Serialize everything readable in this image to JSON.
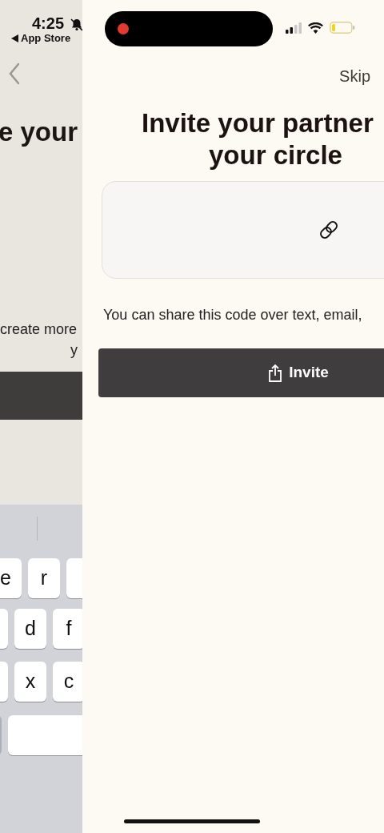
{
  "status_bar": {
    "time": "4:25",
    "back_app": "App Store"
  },
  "background_screen": {
    "title": "e your",
    "body_lines": [
      "create more",
      "y"
    ],
    "keyboard_rows": [
      [
        "e",
        "r"
      ],
      [
        "d",
        "f"
      ],
      [
        "x",
        "c"
      ]
    ]
  },
  "screen": {
    "skip": "Skip",
    "title_lines": [
      "Invite your partner",
      "your circle"
    ],
    "hint": "You can share this code over text, email,",
    "invite_button": "Invite"
  }
}
